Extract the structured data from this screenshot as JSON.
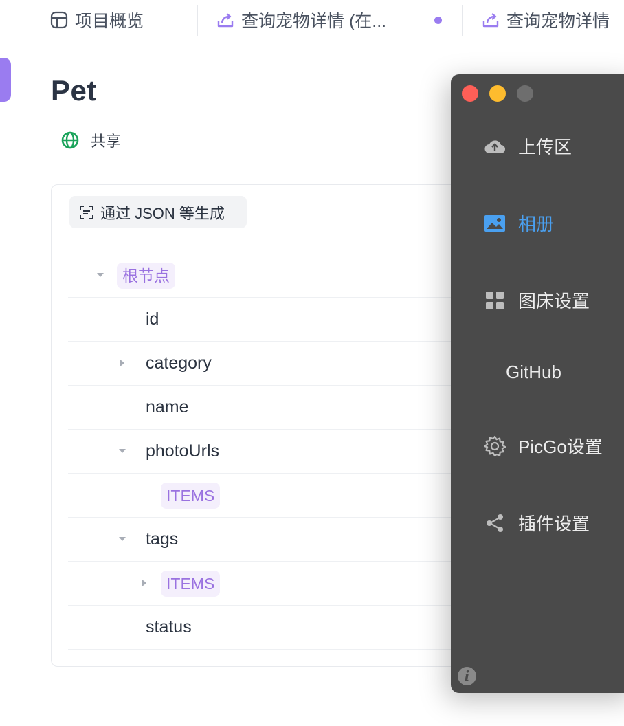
{
  "tabs": [
    {
      "label": "项目概览",
      "icon": "layout-icon"
    },
    {
      "label": "查询宠物详情 (在...",
      "icon": "upload-icon",
      "modified": true
    },
    {
      "label": "查询宠物详情",
      "icon": "upload-icon"
    }
  ],
  "page": {
    "title": "Pet",
    "share_label": "共享"
  },
  "schema": {
    "generate_label": "通过 JSON 等生成",
    "root_label": "根节点",
    "rows": [
      {
        "name": "id"
      },
      {
        "name": "category"
      },
      {
        "name": "name"
      },
      {
        "name": "photoUrls"
      },
      {
        "name": "ITEMS"
      },
      {
        "name": "tags"
      },
      {
        "name": "ITEMS"
      },
      {
        "name": "status"
      }
    ]
  },
  "picgo": {
    "menu": [
      {
        "label": "上传区",
        "icon": "cloud-upload-icon"
      },
      {
        "label": "相册",
        "icon": "image-icon",
        "active": true
      },
      {
        "label": "图床设置",
        "icon": "grid-icon"
      },
      {
        "label": "GitHub",
        "icon": ""
      },
      {
        "label": "PicGo设置",
        "icon": "gear-icon"
      },
      {
        "label": "插件设置",
        "icon": "share-icon"
      }
    ],
    "info_glyph": "i"
  },
  "colors": {
    "accent": "#9a7cf0",
    "active_menu": "#4aa0f0",
    "window_bg": "#4a4a4a",
    "share_green": "#1aa35a"
  }
}
